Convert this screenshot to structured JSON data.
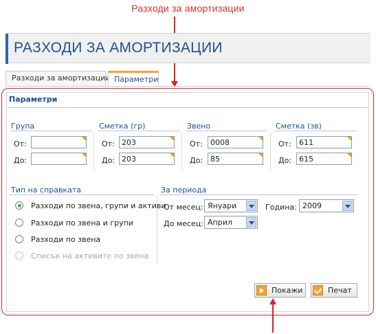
{
  "annotation": {
    "callout": "Разходи за амортизации"
  },
  "header": {
    "title": "РАЗХОДИ ЗА АМОРТИЗАЦИИ"
  },
  "tabs": [
    {
      "label": "Разходи за амортизации",
      "active": false
    },
    {
      "label": "Параметри",
      "active": true
    }
  ],
  "panel": {
    "title": "Параметри",
    "groups": {
      "grupa": {
        "label": "Група",
        "from_label": "От:",
        "to_label": "До:",
        "from_value": "",
        "to_value": ""
      },
      "smetka_gr": {
        "label": "Сметка (гр)",
        "from_label": "От:",
        "to_label": "До:",
        "from_value": "203",
        "to_value": "203"
      },
      "zveno": {
        "label": "Звено",
        "from_label": "От:",
        "to_label": "До:",
        "from_value": "0008",
        "to_value": "85"
      },
      "smetka_zv": {
        "label": "Сметка (зв)",
        "from_label": "От:",
        "to_label": "До:",
        "from_value": "611",
        "to_value": "615"
      }
    },
    "report_type": {
      "label": "Тип на справката",
      "options": [
        {
          "label": "Разходи по звена, групи и активи",
          "selected": true,
          "disabled": false
        },
        {
          "label": "Разходи по звена и групи",
          "selected": false,
          "disabled": false
        },
        {
          "label": "Разходи по звена",
          "selected": false,
          "disabled": false
        },
        {
          "label": "Списък на активите по звена",
          "selected": false,
          "disabled": true
        }
      ]
    },
    "period": {
      "label": "За периода",
      "from_month_label": "От месец:",
      "from_month_value": "Януари",
      "to_month_label": "До месец:",
      "to_month_value": "Април",
      "year_label": "Година:",
      "year_value": "2009"
    },
    "buttons": {
      "show": "Покажи",
      "print": "Печат"
    }
  },
  "colors": {
    "annotation_red": "#d8232a",
    "brand_blue": "#1f4f91",
    "accent_orange": "#f2a23b",
    "radio_green": "#3fb14a"
  }
}
